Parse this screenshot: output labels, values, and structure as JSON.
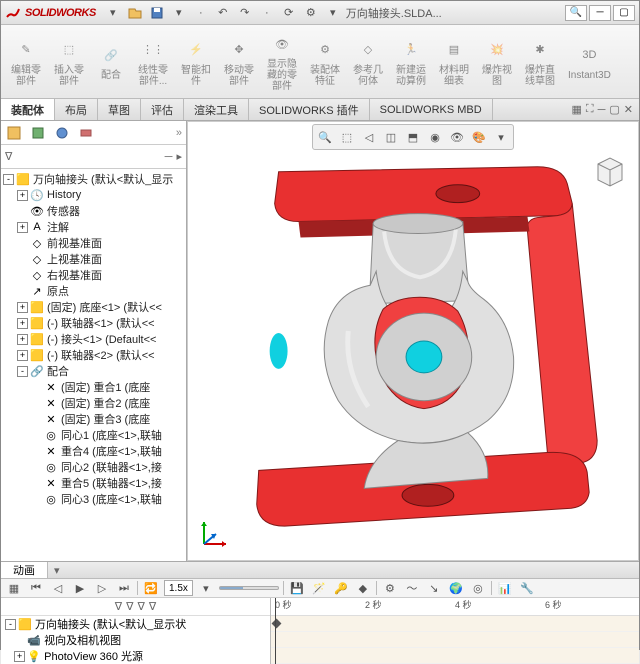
{
  "title": {
    "app": "SOLIDWORKS",
    "doc": "万向轴接头.SLDA..."
  },
  "qat": [
    "new",
    "open",
    "save",
    "print",
    "undo",
    "redo",
    "rebuild",
    "options",
    "filter"
  ],
  "ribbon": [
    {
      "label": "编辑零\n部件",
      "ico": "edit"
    },
    {
      "label": "插入零\n部件",
      "ico": "cube"
    },
    {
      "label": "配合",
      "ico": "mate"
    },
    {
      "label": "线性零\n部件...",
      "ico": "pattern"
    },
    {
      "label": "智能扣\n件",
      "ico": "smart"
    },
    {
      "label": "移动零\n部件",
      "ico": "move"
    },
    {
      "label": "显示隐\n藏的零\n部件",
      "ico": "vis"
    },
    {
      "label": "装配体\n特征",
      "ico": "feat"
    },
    {
      "label": "参考几\n何体",
      "ico": "refgeom"
    },
    {
      "label": "新建运\n动算例",
      "ico": "motion"
    },
    {
      "label": "材料明\n细表",
      "ico": "bom"
    },
    {
      "label": "爆炸视\n图",
      "ico": "explode"
    },
    {
      "label": "爆炸直\n线草图",
      "ico": "expline"
    },
    {
      "label": "Instant3D",
      "ico": "i3d"
    }
  ],
  "tabs": [
    "装配体",
    "布局",
    "草图",
    "评估",
    "渲染工具",
    "SOLIDWORKS 插件",
    "SOLIDWORKS MBD"
  ],
  "tree": {
    "root": "万向轴接头  (默认<默认_显示",
    "items": [
      {
        "ind": 1,
        "exp": "+",
        "ico": "hist",
        "label": "History"
      },
      {
        "ind": 1,
        "exp": "",
        "ico": "sensor",
        "label": "传感器"
      },
      {
        "ind": 1,
        "exp": "+",
        "ico": "annot",
        "label": "注解"
      },
      {
        "ind": 1,
        "exp": "",
        "ico": "plane",
        "label": "前视基准面"
      },
      {
        "ind": 1,
        "exp": "",
        "ico": "plane",
        "label": "上视基准面"
      },
      {
        "ind": 1,
        "exp": "",
        "ico": "plane",
        "label": "右视基准面"
      },
      {
        "ind": 1,
        "exp": "",
        "ico": "origin",
        "label": "原点"
      },
      {
        "ind": 1,
        "exp": "+",
        "ico": "part",
        "label": "(固定) 底座<1> (默认<<"
      },
      {
        "ind": 1,
        "exp": "+",
        "ico": "part",
        "label": "(-) 联轴器<1> (默认<<"
      },
      {
        "ind": 1,
        "exp": "+",
        "ico": "part",
        "label": "(-) 接头<1> (Default<<"
      },
      {
        "ind": 1,
        "exp": "+",
        "ico": "part",
        "label": "(-) 联轴器<2> (默认<<"
      },
      {
        "ind": 1,
        "exp": "-",
        "ico": "mates",
        "label": "配合"
      },
      {
        "ind": 2,
        "exp": "",
        "ico": "coin",
        "label": "(固定) 重合1 (底座"
      },
      {
        "ind": 2,
        "exp": "",
        "ico": "coin",
        "label": "(固定) 重合2 (底座"
      },
      {
        "ind": 2,
        "exp": "",
        "ico": "coin",
        "label": "(固定) 重合3 (底座"
      },
      {
        "ind": 2,
        "exp": "",
        "ico": "conc",
        "label": "同心1 (底座<1>,联轴"
      },
      {
        "ind": 2,
        "exp": "",
        "ico": "coin",
        "label": "重合4 (底座<1>,联轴"
      },
      {
        "ind": 2,
        "exp": "",
        "ico": "conc",
        "label": "同心2 (联轴器<1>,接"
      },
      {
        "ind": 2,
        "exp": "",
        "ico": "coin",
        "label": "重合5 (联轴器<1>,接"
      },
      {
        "ind": 2,
        "exp": "",
        "ico": "conc",
        "label": "同心3 (底座<1>,联轴"
      }
    ]
  },
  "motion": {
    "tab": "动画",
    "speed": "1.5x",
    "ticks": [
      "0 秒",
      "2 秒",
      "4 秒",
      "6 秒"
    ],
    "rows": [
      {
        "exp": "-",
        "ico": "asm",
        "label": "万向轴接头 (默认<默认_显示状"
      },
      {
        "exp": "",
        "ico": "cam",
        "label": "  视向及相机视图",
        "ind": 1
      },
      {
        "exp": "+",
        "ico": "light",
        "label": "  PhotoView 360 光源",
        "ind": 1
      }
    ]
  },
  "colors": {
    "accent": "#e03030",
    "sel": "#10c0d0"
  }
}
